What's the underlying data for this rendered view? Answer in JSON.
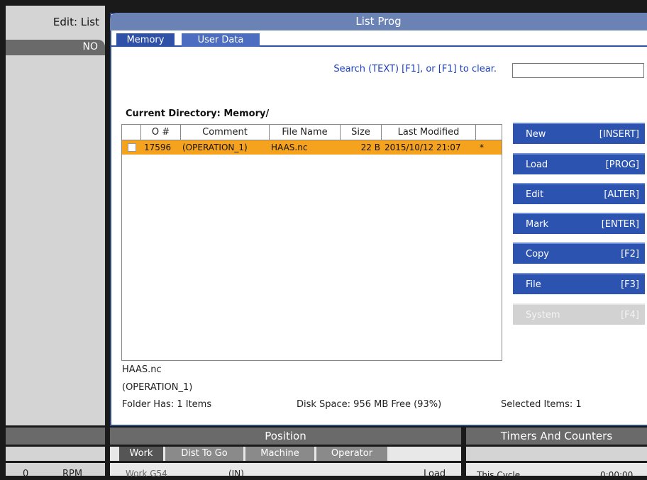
{
  "left_panel": {
    "mode": "Edit: List",
    "sub": "NO"
  },
  "window": {
    "title": "List Prog"
  },
  "tabs": [
    {
      "label": "Memory",
      "active": true
    },
    {
      "label": "User Data",
      "active": false
    }
  ],
  "search": {
    "hint": "Search (TEXT) [F1], or [F1] to clear.",
    "value": ""
  },
  "current_directory": "Current Directory: Memory/",
  "table": {
    "columns": [
      "O #",
      "Comment",
      "File Name",
      "Size",
      "Last Modified"
    ],
    "rows": [
      {
        "checked": false,
        "o_num": "17596",
        "comment": "(OPERATION_1)",
        "file_name": "HAAS.nc",
        "size": "22 B",
        "last_modified": "2015/10/12 21:07",
        "flag": "*"
      }
    ]
  },
  "selected_file": {
    "name": "HAAS.nc",
    "comment": "(OPERATION_1)"
  },
  "status": {
    "folder": "Folder Has: 1 Items",
    "disk": "Disk Space: 956 MB Free (93%)",
    "selected": "Selected Items: 1"
  },
  "buttons": [
    {
      "label": "New",
      "key": "[INSERT]",
      "enabled": true
    },
    {
      "label": "Load",
      "key": "[PROG]",
      "enabled": true
    },
    {
      "label": "Edit",
      "key": "[ALTER]",
      "enabled": true
    },
    {
      "label": "Mark",
      "key": "[ENTER]",
      "enabled": true
    },
    {
      "label": "Copy",
      "key": "[F2]",
      "enabled": true
    },
    {
      "label": "File",
      "key": "[F3]",
      "enabled": true
    },
    {
      "label": "System",
      "key": "[F4]",
      "enabled": false
    }
  ],
  "bottom": {
    "position_title": "Position",
    "timers_title": "Timers And Counters",
    "position_tabs": [
      {
        "label": "Work",
        "active": true
      },
      {
        "label": "Dist To Go",
        "active": false
      },
      {
        "label": "Machine",
        "active": false
      },
      {
        "label": "Operator",
        "active": false
      }
    ],
    "spindle_value": "0",
    "spindle_unit": "RPM",
    "work_offset": "Work G54",
    "units": "(IN)",
    "load_label": "Load",
    "this_cycle_label": "This Cycle",
    "this_cycle_value": "0:00:00"
  },
  "colors": {
    "header_blue": "#6b82b5",
    "tab_blue": "#2f52a8",
    "button_blue": "#2d53b0",
    "row_highlight": "#f5a21e",
    "hint_text": "#1a3ec0"
  }
}
